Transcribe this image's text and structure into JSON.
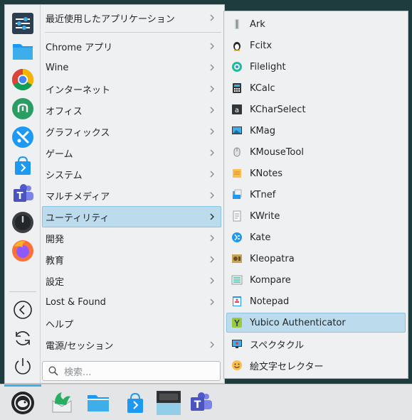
{
  "menu": {
    "items": [
      {
        "label": "最近使用したアプリケーション",
        "has_sub": true,
        "active": false
      },
      {
        "label": "Chrome アプリ",
        "has_sub": true,
        "active": false
      },
      {
        "label": "Wine",
        "has_sub": true,
        "active": false
      },
      {
        "label": "インターネット",
        "has_sub": true,
        "active": false
      },
      {
        "label": "オフィス",
        "has_sub": true,
        "active": false
      },
      {
        "label": "グラフィックス",
        "has_sub": true,
        "active": false
      },
      {
        "label": "ゲーム",
        "has_sub": true,
        "active": false
      },
      {
        "label": "システム",
        "has_sub": true,
        "active": false
      },
      {
        "label": "マルチメディア",
        "has_sub": true,
        "active": false
      },
      {
        "label": "ユーティリティ",
        "has_sub": true,
        "active": true
      },
      {
        "label": "開発",
        "has_sub": true,
        "active": false
      },
      {
        "label": "教育",
        "has_sub": true,
        "active": false
      },
      {
        "label": "設定",
        "has_sub": true,
        "active": false
      },
      {
        "label": "Lost & Found",
        "has_sub": true,
        "active": false
      },
      {
        "label": "ヘルプ",
        "has_sub": false,
        "active": false
      },
      {
        "label": "電源/セッション",
        "has_sub": true,
        "active": false
      }
    ],
    "search_placeholder": "検索..."
  },
  "favorites": [
    {
      "icon": "settings-sliders-icon"
    },
    {
      "icon": "folder-icon"
    },
    {
      "icon": "chrome-icon"
    },
    {
      "icon": "mastodon-icon"
    },
    {
      "icon": "kde-connect-icon"
    },
    {
      "icon": "discover-icon"
    },
    {
      "icon": "teams-icon"
    },
    {
      "icon": "power-dial-icon"
    },
    {
      "icon": "firefox-icon"
    }
  ],
  "system_buttons": [
    {
      "icon": "back-circle-icon"
    },
    {
      "icon": "refresh-icon"
    },
    {
      "icon": "power-icon"
    }
  ],
  "submenu": {
    "items": [
      {
        "label": "Ark",
        "icon": "ark-icon"
      },
      {
        "label": "Fcitx",
        "icon": "penguin-icon"
      },
      {
        "label": "Filelight",
        "icon": "filelight-icon"
      },
      {
        "label": "KCalc",
        "icon": "calculator-icon"
      },
      {
        "label": "KCharSelect",
        "icon": "charselect-icon"
      },
      {
        "label": "KMag",
        "icon": "magnifier-icon"
      },
      {
        "label": "KMouseTool",
        "icon": "mouse-icon"
      },
      {
        "label": "KNotes",
        "icon": "notes-icon"
      },
      {
        "label": "KTnef",
        "icon": "ktnef-icon"
      },
      {
        "label": "KWrite",
        "icon": "kwrite-icon"
      },
      {
        "label": "Kate",
        "icon": "kate-icon"
      },
      {
        "label": "Kleopatra",
        "icon": "kleopatra-icon"
      },
      {
        "label": "Kompare",
        "icon": "kompare-icon"
      },
      {
        "label": "Notepad",
        "icon": "notepad-icon"
      },
      {
        "label": "Yubico Authenticator",
        "icon": "yubico-icon",
        "active": true
      },
      {
        "label": "スペクタクル",
        "icon": "spectacle-icon"
      },
      {
        "label": "絵文字セレクター",
        "icon": "emoji-icon"
      }
    ]
  },
  "taskbar": {
    "items": [
      {
        "icon": "opensuse-launcher-icon"
      },
      {
        "icon": "kmail-icon"
      },
      {
        "icon": "dolphin-icon"
      },
      {
        "icon": "discover-icon"
      },
      {
        "icon": "window-thumbnail-icon"
      },
      {
        "icon": "teams-icon"
      }
    ]
  },
  "colors": {
    "accent": "#3daee9",
    "highlight": "#bcdcee",
    "menu_bg": "#eff0f1",
    "desktop_bg": "#1e3b3e"
  }
}
